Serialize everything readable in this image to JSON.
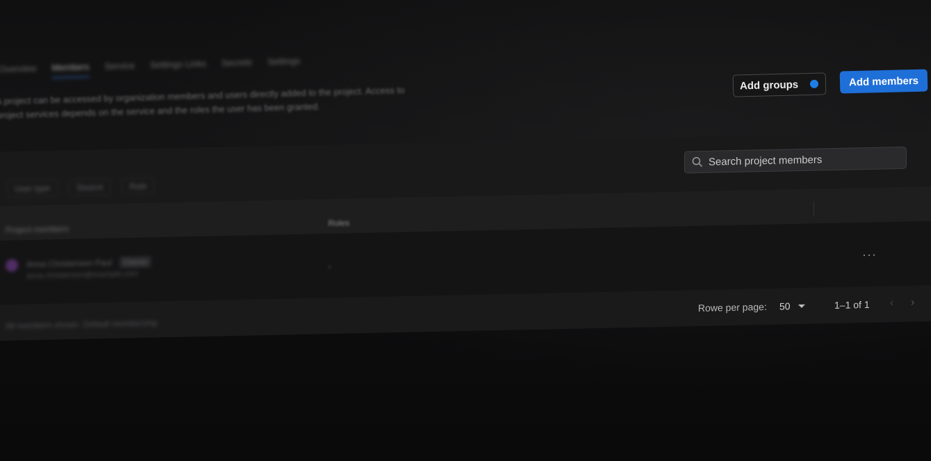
{
  "tabs": [
    {
      "label": "Overview",
      "active": false
    },
    {
      "label": "Members",
      "active": true
    },
    {
      "label": "Service",
      "active": false
    },
    {
      "label": "Settings Links",
      "active": false
    },
    {
      "label": "Secrets",
      "active": false
    },
    {
      "label": "Settings",
      "active": false
    }
  ],
  "description": "A project can be accessed by organization members and users directly added to the project. Access to project services depends on the service and the roles the user has been granted.",
  "actions": {
    "add_groups_label": "Add groups",
    "add_members_label": "Add members"
  },
  "search": {
    "placeholder": "Search project members"
  },
  "filters": [
    "User type",
    "Source",
    "Role"
  ],
  "table": {
    "headers": [
      "Project members",
      "Roles"
    ],
    "rows": [
      {
        "name": "Anna Christensen Paul",
        "badge": "Owner",
        "email": "anna.christensen@example.com",
        "role": "-"
      }
    ]
  },
  "footer": {
    "left_text": "All members shown. Default membership",
    "rows_per_page_label": "Rowe per page:",
    "rows_per_page_value": "50",
    "range": "1–1 of 1"
  },
  "colors": {
    "accent": "#1f6fd8",
    "dot": "#1e7ee6",
    "background": "#0e0e0f"
  }
}
